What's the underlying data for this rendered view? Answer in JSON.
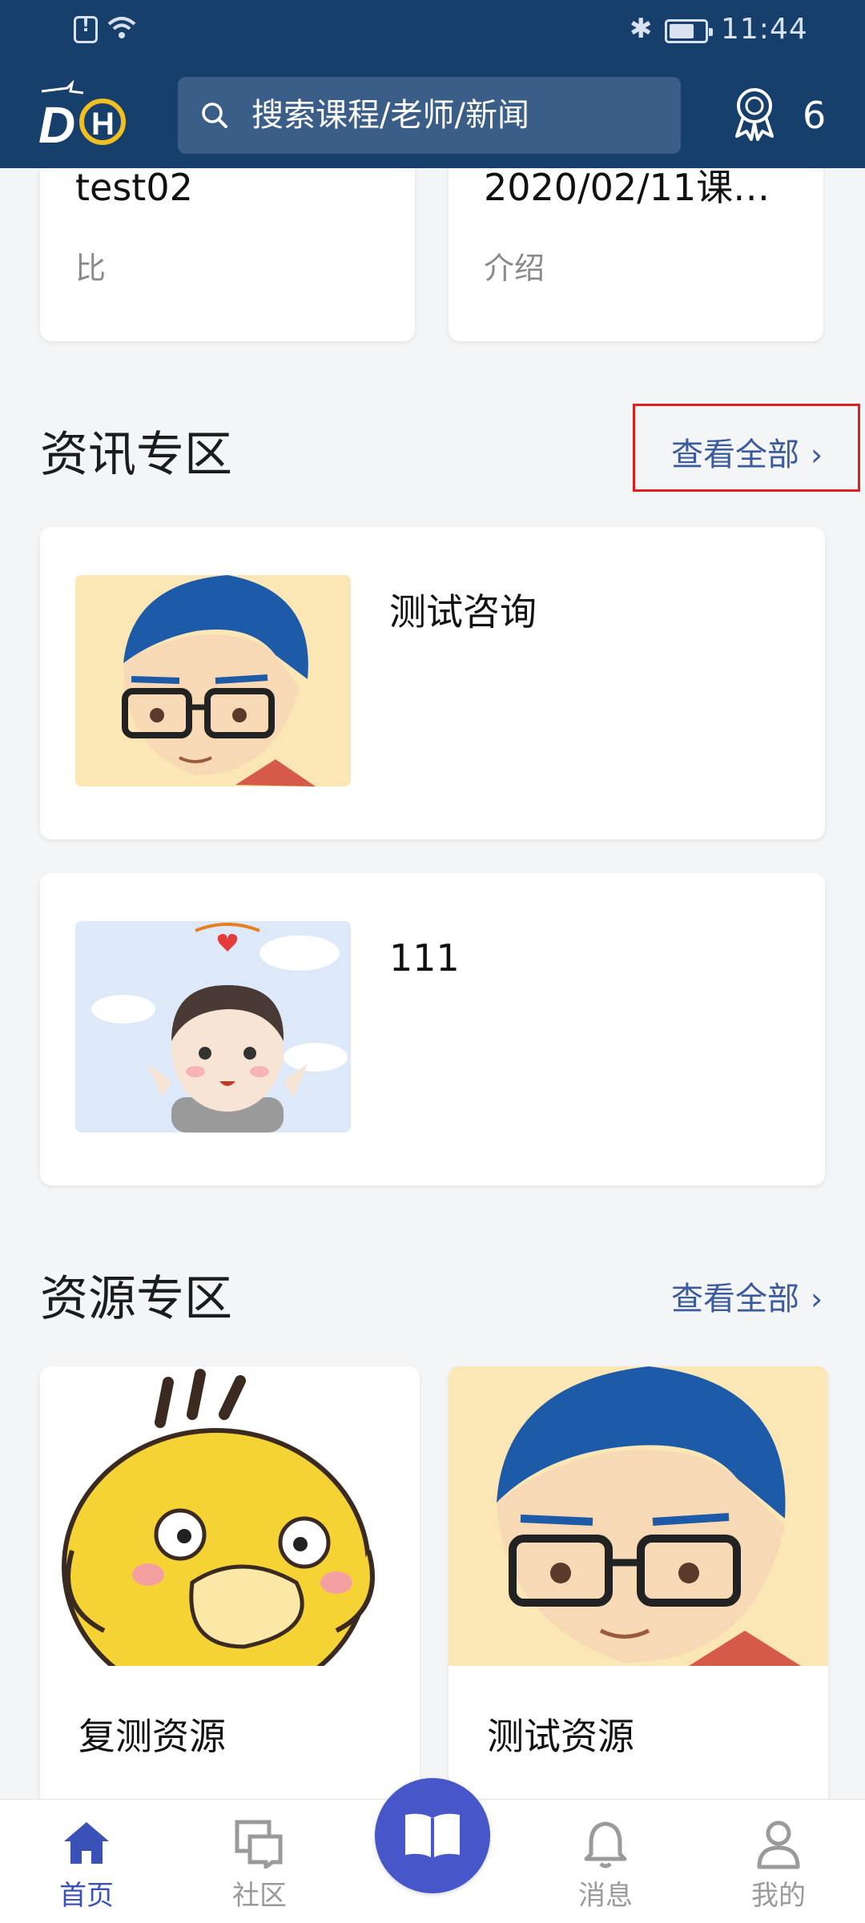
{
  "status_bar": {
    "time": "11:44"
  },
  "header": {
    "logo_text": "DH",
    "search_placeholder": "搜索课程/老师/新闻",
    "medal_count": "6"
  },
  "course_cards": [
    {
      "title": "test02",
      "desc": "比"
    },
    {
      "title": "2020/02/11课…",
      "desc": "介绍"
    }
  ],
  "news_section": {
    "title": "资讯专区",
    "see_all": "查看全部",
    "items": [
      {
        "title": "测试咨询",
        "thumb": "cartoon-boy-glasses"
      },
      {
        "title": "111",
        "thumb": "cartoon-kid-heart"
      }
    ]
  },
  "resource_section": {
    "title": "资源专区",
    "see_all": "查看全部",
    "items": [
      {
        "title": "复测资源",
        "image": "yellow-duck-cartoon"
      },
      {
        "title": "测试资源",
        "image": "cartoon-boy-glasses"
      }
    ]
  },
  "bottom_nav": {
    "items": [
      {
        "label": "首页",
        "icon": "home-icon",
        "active": true
      },
      {
        "label": "社区",
        "icon": "community-icon",
        "active": false
      },
      {
        "label": "",
        "icon": "book-icon",
        "active": false
      },
      {
        "label": "消息",
        "icon": "bell-icon",
        "active": false
      },
      {
        "label": "我的",
        "icon": "user-icon",
        "active": false
      }
    ]
  },
  "colors": {
    "header_bg": "#163f6c",
    "accent": "#3a52b8",
    "link": "#3b5b9a",
    "highlight_box": "#e02020"
  }
}
